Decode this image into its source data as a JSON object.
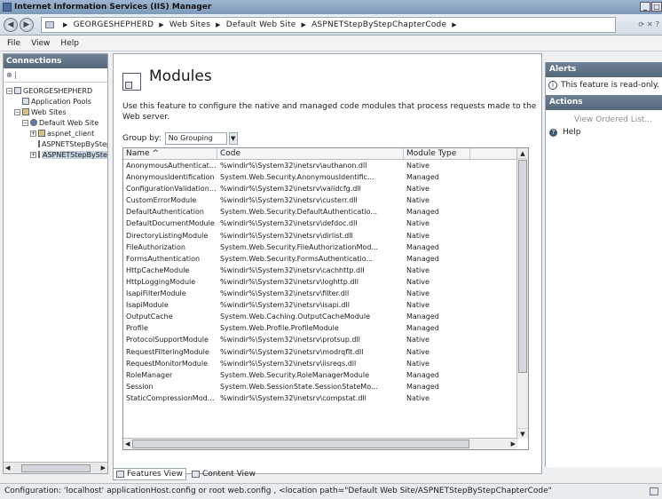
{
  "window": {
    "title": "Internet Information Services (IIS) Manager"
  },
  "address": {
    "crumbs": [
      "GEORGESHEPHERD",
      "Web Sites",
      "Default Web Site",
      "ASPNETStepByStepChapterCode"
    ]
  },
  "menu": {
    "items": [
      "File",
      "View",
      "Help"
    ]
  },
  "connections": {
    "header": "Connections",
    "tree": [
      {
        "label": "GEORGESHEPHERD",
        "expander": "−",
        "indent": 0,
        "icon": "server"
      },
      {
        "label": "Application Pools",
        "expander": "",
        "indent": 1,
        "icon": "app-pool"
      },
      {
        "label": "Web Sites",
        "expander": "−",
        "indent": 1,
        "icon": "folder"
      },
      {
        "label": "Default Web Site",
        "expander": "−",
        "indent": 2,
        "icon": "globe"
      },
      {
        "label": "aspnet_client",
        "expander": "+",
        "indent": 3,
        "icon": "folder"
      },
      {
        "label": "ASPNETStepByStep",
        "expander": "",
        "indent": 3,
        "icon": "app"
      },
      {
        "label": "ASPNETStepByStepChapterCode",
        "expander": "+",
        "indent": 3,
        "icon": "app",
        "selected": true
      }
    ]
  },
  "main": {
    "title": "Modules",
    "description": "Use this feature to configure the native and managed code modules that process requests made to the Web server.",
    "group_by_label": "Group by:",
    "group_by_value": "No Grouping",
    "columns": [
      "Name",
      "Code",
      "Module Type"
    ],
    "rows": [
      [
        "AnonymousAuthenticatio...",
        "%windir%\\System32\\inetsrv\\authanon.dll",
        "Native"
      ],
      [
        "AnonymousIdentification",
        "System.Web.Security.AnonymousIdentific...",
        "Managed"
      ],
      [
        "ConfigurationValidationMo...",
        "%windir%\\System32\\inetsrv\\validcfg.dll",
        "Native"
      ],
      [
        "CustomErrorModule",
        "%windir%\\System32\\inetsrv\\custerr.dll",
        "Native"
      ],
      [
        "DefaultAuthentication",
        "System.Web.Security.DefaultAuthenticatio...",
        "Managed"
      ],
      [
        "DefaultDocumentModule",
        "%windir%\\System32\\inetsrv\\defdoc.dll",
        "Native"
      ],
      [
        "DirectoryListingModule",
        "%windir%\\System32\\inetsrv\\dirlist.dll",
        "Native"
      ],
      [
        "FileAuthorization",
        "System.Web.Security.FileAuthorizationMod...",
        "Managed"
      ],
      [
        "FormsAuthentication",
        "System.Web.Security.FormsAuthenticatio...",
        "Managed"
      ],
      [
        "HttpCacheModule",
        "%windir%\\System32\\inetsrv\\cachhttp.dll",
        "Native"
      ],
      [
        "HttpLoggingModule",
        "%windir%\\System32\\inetsrv\\loghttp.dll",
        "Native"
      ],
      [
        "IsapiFilterModule",
        "%windir%\\System32\\inetsrv\\filter.dll",
        "Native"
      ],
      [
        "IsapiModule",
        "%windir%\\System32\\inetsrv\\isapi.dll",
        "Native"
      ],
      [
        "OutputCache",
        "System.Web.Caching.OutputCacheModule",
        "Managed"
      ],
      [
        "Profile",
        "System.Web.Profile.ProfileModule",
        "Managed"
      ],
      [
        "ProtocolSupportModule",
        "%windir%\\System32\\inetsrv\\protsup.dll",
        "Native"
      ],
      [
        "RequestFilteringModule",
        "%windir%\\System32\\inetsrv\\modrqflt.dll",
        "Native"
      ],
      [
        "RequestMonitorModule",
        "%windir%\\System32\\inetsrv\\iisreqs.dll",
        "Native"
      ],
      [
        "RoleManager",
        "System.Web.Security.RoleManagerModule",
        "Managed"
      ],
      [
        "Session",
        "System.Web.SessionState.SessionStateMo...",
        "Managed"
      ],
      [
        "StaticCompressionModule",
        "%windir%\\System32\\inetsrv\\compstat.dll",
        "Native"
      ]
    ]
  },
  "view_tabs": {
    "features": "Features View",
    "content": "Content View"
  },
  "alerts": {
    "header": "Alerts",
    "message": "This feature is read-only."
  },
  "actions": {
    "header": "Actions",
    "view_ordered_list": "View Ordered List...",
    "help": "Help"
  },
  "status": {
    "text": "Configuration: 'localhost' applicationHost.config or root web.config , <location path=\"Default Web Site/ASPNETStepByStepChapterCode\""
  }
}
